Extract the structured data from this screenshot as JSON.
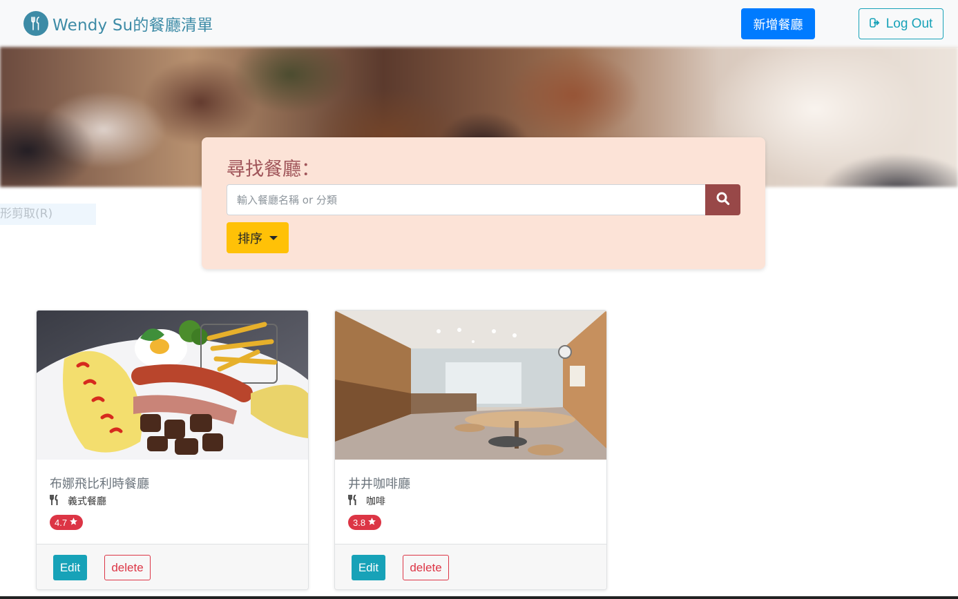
{
  "navbar": {
    "brand": "Wendy Su的餐廳清單",
    "brand_icon": "utensils-icon",
    "new_button": "新增餐廳",
    "logout_button": "Log Out",
    "logout_icon": "sign-out-icon",
    "accent": "#3d8ba6"
  },
  "overlay_hint": "形剪取(R)",
  "search": {
    "title": "尋找餐廳：",
    "placeholder": "輸入餐廳名稱 or 分類",
    "button_icon": "search-icon",
    "sort_label": "排序"
  },
  "restaurants": [
    {
      "name": "布娜飛比利時餐廳",
      "category": "義式餐廳",
      "category_icon": "utensils-icon",
      "rating": "4.7",
      "rating_icon": "star-icon",
      "edit_label": "Edit",
      "delete_label": "delete"
    },
    {
      "name": "井井咖啡廳",
      "category": "咖啡",
      "category_icon": "utensils-icon",
      "rating": "3.8",
      "rating_icon": "star-icon",
      "edit_label": "Edit",
      "delete_label": "delete"
    }
  ],
  "colors": {
    "primary": "#007bff",
    "info": "#17a2b8",
    "danger": "#dc3545",
    "warning": "#ffc107",
    "search_card_bg": "#fce3d7",
    "search_button": "#984848"
  }
}
